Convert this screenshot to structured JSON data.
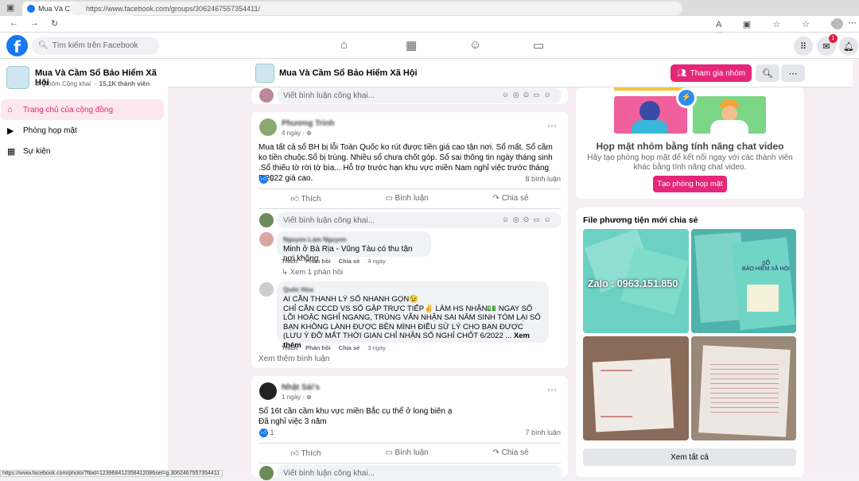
{
  "browser": {
    "tab_title": "Mua Và Cầm Sổ Bảo Hiểm Xã Hội",
    "url": "https://www.facebook.com/groups/3062467557354411/",
    "status_url": "https://www.facebook.com/photo/?fbid=123968412358412086set=g.3062467557354411"
  },
  "header": {
    "search_placeholder": "Tìm kiếm trên Facebook",
    "notif_count": "1"
  },
  "group": {
    "name": "Mua Và Cầm Sổ Bảo Hiểm Xã Hội",
    "privacy": "Nhóm Công khai",
    "members": "15,1K thành viên",
    "join_label": "Tham gia nhóm"
  },
  "sidebar": {
    "items": [
      {
        "label": "Trang chủ của cộng đồng"
      },
      {
        "label": "Phòng họp mặt"
      },
      {
        "label": "Sự kiện"
      }
    ]
  },
  "comment_placeholder": "Viết bình luận công khai...",
  "posts": [
    {
      "author": "Phương Trinh",
      "time": "4 ngày · ",
      "text": "Mua tất cả sổ BH bị lỗi Toàn Quốc ko rút được tiền giá cao tận nơi. Sổ mất. Sổ cầm ko tiền chuộc.Sổ bị trùng. Nhiều sổ chưa chốt góp. Sổ sai thông tin ngày tháng sinh .Sổ thiếu tờ rời tờ bìa... Hỗ trợ  trước hạn khu vực miền Nam nghỉ việc trước tháng 5.2022 giá cao.",
      "reactions": "8",
      "comments": "8 bình luận"
    },
    {
      "author": "Nhật Sái's",
      "time": "1 ngày · ",
      "text": "Sổ 16t cần cầm khu vực miền Bắc cụ thể ở long biên ạ\nĐã nghỉ việc 3 năm",
      "reactions": "1",
      "comments": "7 bình luận"
    }
  ],
  "actions": {
    "like": "Thích",
    "comment": "Bình luận",
    "share": "Chia sẻ"
  },
  "comments": [
    {
      "author": "Nguyen Lam Nguyen",
      "text": "Minh ở Bà Rịa - Vũng Tàu có thu tận nơi không",
      "like": "Thích",
      "reply": "Phản hồi",
      "share": "Chia sẻ",
      "time": "4 ngày",
      "replies": "Xem 1 phản hồi"
    },
    {
      "author": "Quốc Hòa",
      "text": "AI CẦN THANH LÝ SỔ NHANH GỌN😉\nCHỈ CẦN CCCD VS SỔ GẶP TRỰC TIẾP✌️ LÀM HS NHẬN💵 NGAY SỔ LỖI HOẶC NGHỈ NGANG, TRÙNG VẪN NHẬN SAI NĂM SINH TÓM LẠI SỔ BẠN KHÔNG LÀNH ĐƯỢC BÊN MÌNH ĐIỀU SỬ LÝ CHO BẠN ĐƯỢC (LƯU Ý ĐỠ MẤT THỜI GIAN CHỈ NHẬN SỔ NGHỈ CHỐT 6/2022 ...",
      "more": "Xem thêm",
      "like": "Thích",
      "reply": "Phản hồi",
      "share": "Chia sẻ",
      "time": "3 ngày"
    }
  ],
  "more_comments": "Xem thêm bình luận",
  "right": {
    "meet_title": "Họp mặt nhóm bằng tính năng chat video",
    "meet_desc": "Hãy tạo phòng họp mặt để kết nối ngay với các thành viên khác bằng tính năng chat video.",
    "meet_btn": "Tạo phòng họp mặt",
    "media_title": "File phương tiện mới chia sẻ",
    "photo_text": "Zalo : 0963.151.850",
    "photo_text2": "SỔ\nBẢO HIỂM XÃ HỘI",
    "see_all": "Xem tất cả"
  },
  "colors": {
    "accent": "#e42778",
    "fb_blue": "#1877f2"
  }
}
